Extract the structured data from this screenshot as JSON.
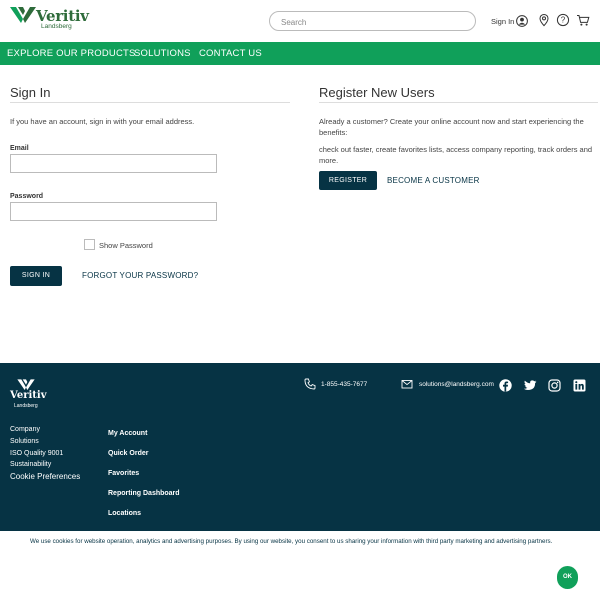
{
  "brand": {
    "name": "Veritiv",
    "sub": "Landsberg"
  },
  "header": {
    "search_placeholder": "Search",
    "sign_in_label": "Sign In"
  },
  "nav": {
    "items": [
      "EXPLORE OUR PRODUCTS",
      "SOLUTIONS",
      "CONTACT US"
    ]
  },
  "signin": {
    "title": "Sign In",
    "intro": "If you have an account, sign in with your email address.",
    "email_label": "Email",
    "email_value": "",
    "password_label": "Password",
    "password_value": "",
    "show_password_label": "Show Password",
    "submit_label": "SIGN IN",
    "forgot_label": "FORGOT YOUR PASSWORD?"
  },
  "register": {
    "title": "Register New Users",
    "intro": "Already a customer? Create your online account now and start experiencing the benefits:",
    "benefits": "check out faster, create favorites lists, access company reporting, track orders and more.",
    "register_label": "REGISTER",
    "become_label": "BECOME A CUSTOMER"
  },
  "footer": {
    "phone": "1-855-435-7677",
    "email": "solutions@landsberg.com",
    "links": [
      "Company",
      "Solutions",
      "ISO Quality 9001",
      "Sustainability",
      "Cookie Preferences"
    ],
    "account_links": [
      "My Account",
      "Quick Order",
      "Favorites",
      "Reporting Dashboard",
      "Locations"
    ],
    "social_icons": [
      "facebook-icon",
      "twitter-icon",
      "instagram-icon",
      "linkedin-icon"
    ]
  },
  "cookie": {
    "text": "We use cookies for website operation, analytics and advertising purposes. By using our website, you consent to us sharing your information with third party marketing and advertising partners.",
    "ok_label": "OK"
  },
  "colors": {
    "brand_green": "#10a05a",
    "logo_green": "#2e6b3a",
    "navy": "#063344"
  }
}
